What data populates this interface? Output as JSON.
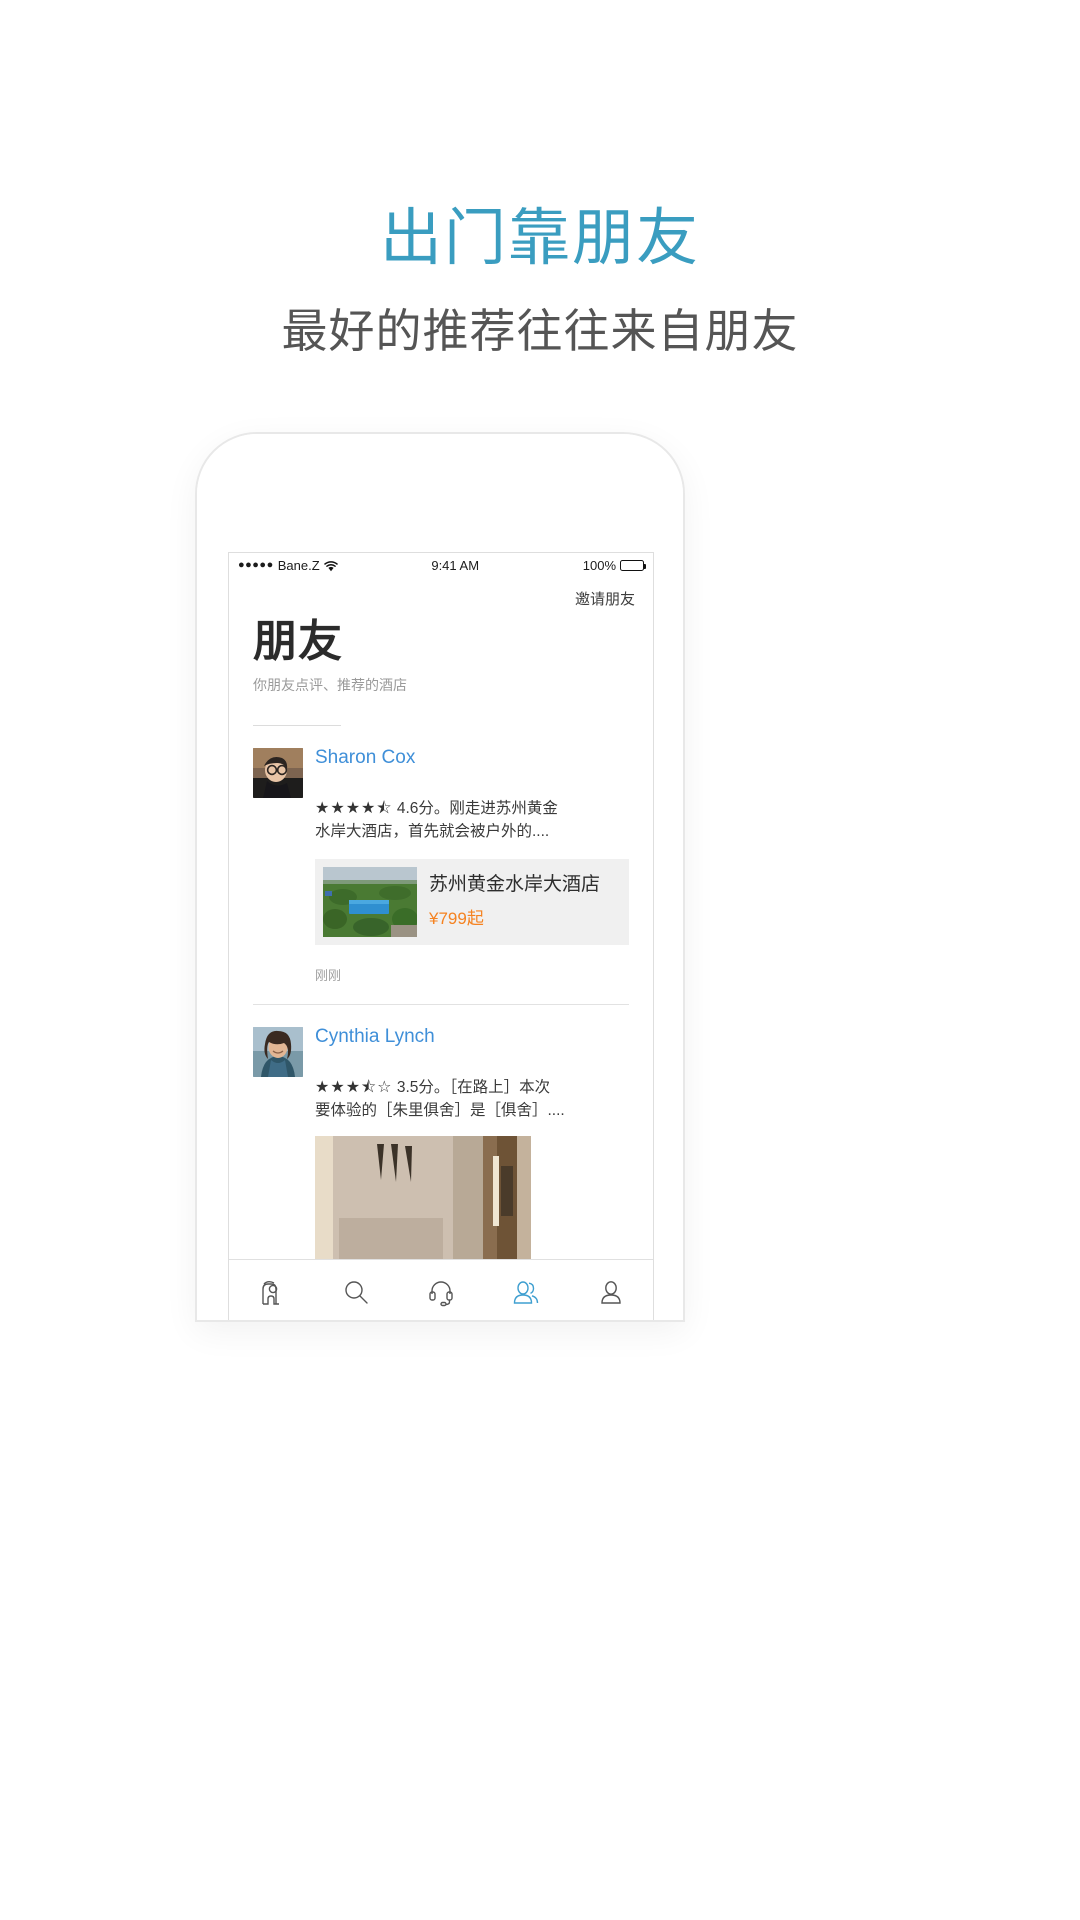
{
  "promo": {
    "title": "出门靠朋友",
    "subtitle": "最好的推荐往往来自朋友",
    "title_color": "#3a9dc0",
    "subtitle_color": "#555555"
  },
  "status_bar": {
    "signal_dots": "●●●●●",
    "carrier": "Bane.Z",
    "wifi_icon": "wifi-icon",
    "time": "9:41 AM",
    "battery_percent": "100%",
    "battery_icon": "battery-full-icon"
  },
  "header": {
    "invite_label": "邀请朋友",
    "title": "朋友",
    "subtitle": "你朋友点评、推荐的酒店"
  },
  "reviews": [
    {
      "name": "Sharon Cox",
      "name_color": "#3f8fd8",
      "stars": "★★★★⯪",
      "score_text": "4.6分。刚走进苏州黄金",
      "text_line2": "水岸大酒店，首先就会被户外的....",
      "hotel": {
        "name": "苏州黄金水岸大酒店",
        "price": "¥799起",
        "price_color": "#f58220",
        "thumb": "hotel-aerial-photo"
      },
      "time": "刚刚"
    },
    {
      "name": "Cynthia Lynch",
      "name_color": "#3f8fd8",
      "stars": "★★★⯪☆",
      "score_text": "3.5分。［在路上］本次",
      "text_line2": "要体验的［朱里俱舍］是［俱舍］....",
      "photo": "room-interior-photo"
    }
  ],
  "tabbar": {
    "active_color": "#3f9fd0",
    "inactive_color": "#555555",
    "items": [
      {
        "icon": "hotel-bed-icon",
        "active": false
      },
      {
        "icon": "search-icon",
        "active": false
      },
      {
        "icon": "headset-support-icon",
        "active": false
      },
      {
        "icon": "friends-icon",
        "active": true
      },
      {
        "icon": "profile-person-icon",
        "active": false
      }
    ]
  }
}
